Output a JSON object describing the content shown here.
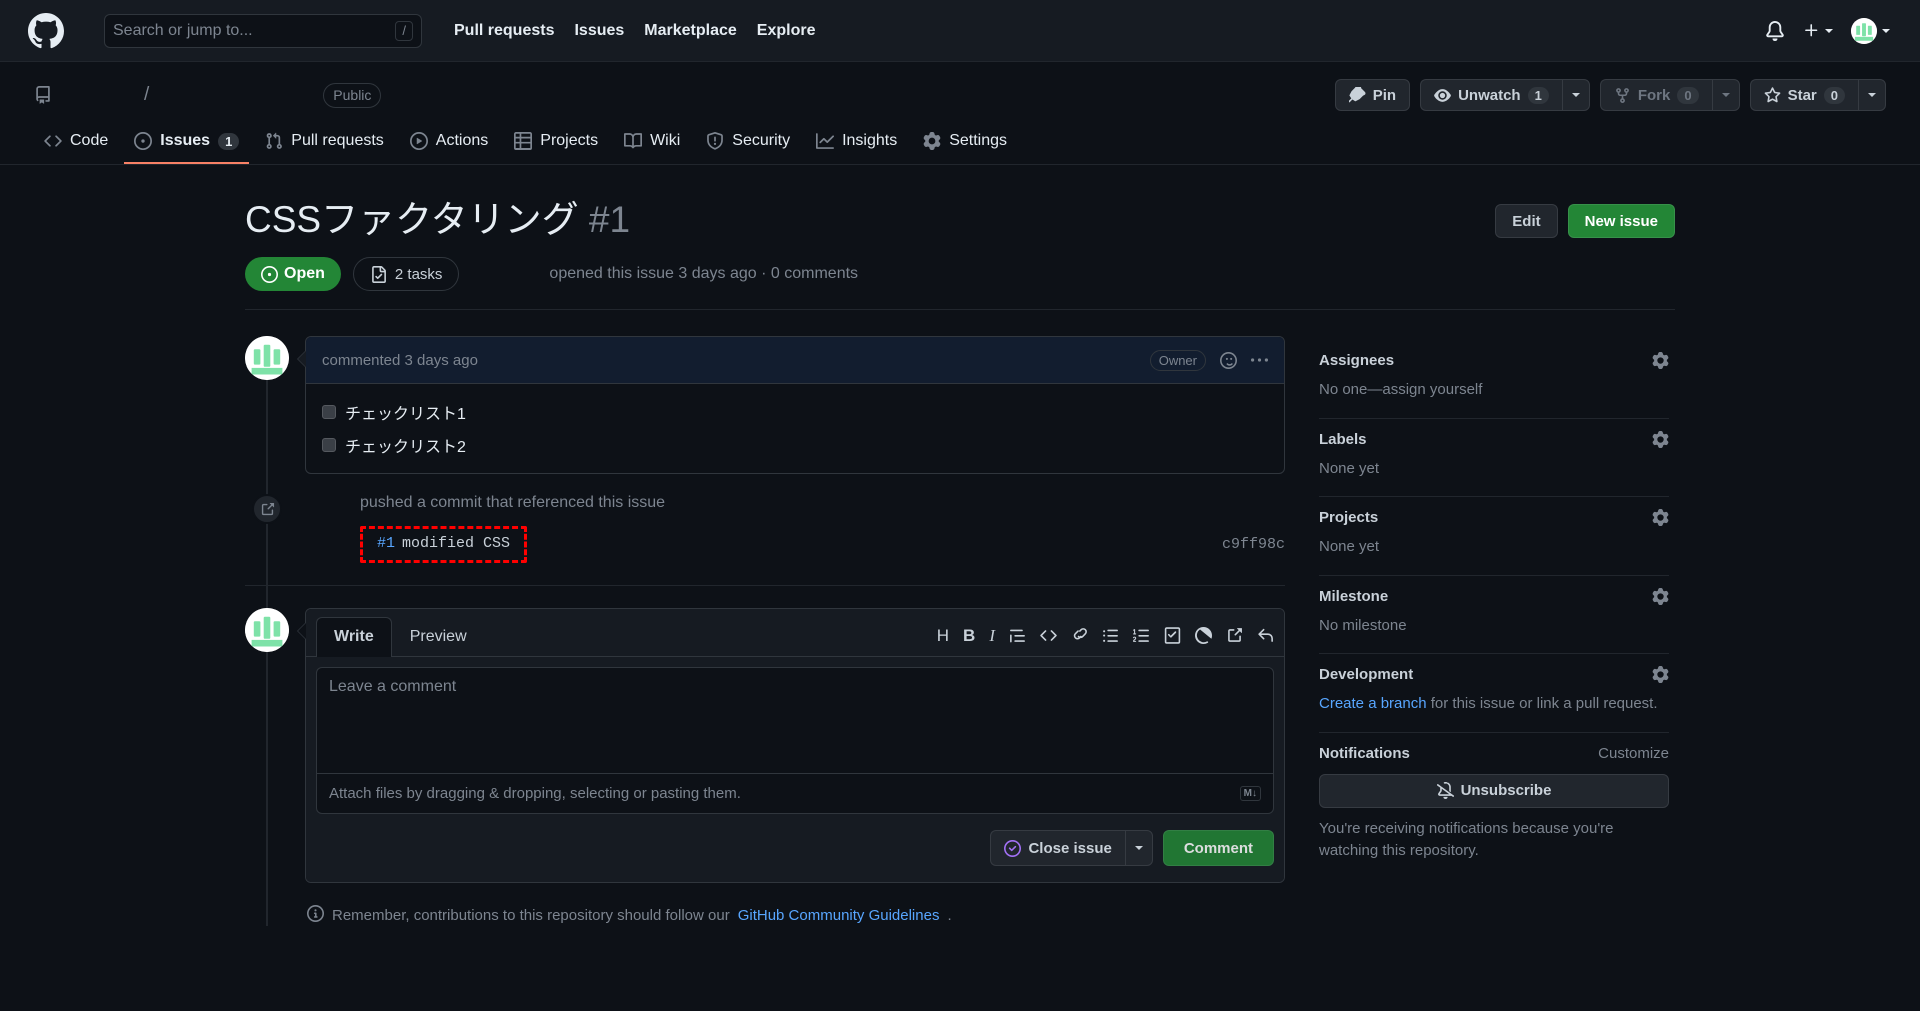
{
  "header": {
    "logo_icon": "github-mark-icon",
    "search_placeholder": "Search or jump to...",
    "search_value": "",
    "slash_key": "/",
    "nav": [
      {
        "label": "Pull requests"
      },
      {
        "label": "Issues"
      },
      {
        "label": "Marketplace"
      },
      {
        "label": "Explore"
      }
    ],
    "notifications_icon": "bell-icon",
    "create_new_icon": "plus-icon",
    "profile_icon": "avatar"
  },
  "repo": {
    "repo_icon": "repo-icon",
    "owner": "",
    "separator": "/",
    "name": "",
    "visibility": "Public",
    "actions": {
      "pin_label": "Pin",
      "pin_icon": "pin-icon",
      "unwatch_label": "Unwatch",
      "unwatch_icon": "eye-icon",
      "unwatch_count": "1",
      "fork_label": "Fork",
      "fork_icon": "fork-icon",
      "fork_count": "0",
      "star_label": "Star",
      "star_icon": "star-icon",
      "star_count": "0"
    },
    "nav": [
      {
        "label": "Code",
        "icon": "code-icon",
        "count": null,
        "selected": false
      },
      {
        "label": "Issues",
        "icon": "issue-opened-icon",
        "count": "1",
        "selected": true
      },
      {
        "label": "Pull requests",
        "icon": "git-pull-request-icon",
        "count": null,
        "selected": false
      },
      {
        "label": "Actions",
        "icon": "play-icon",
        "count": null,
        "selected": false
      },
      {
        "label": "Projects",
        "icon": "table-icon",
        "count": null,
        "selected": false
      },
      {
        "label": "Wiki",
        "icon": "book-icon",
        "count": null,
        "selected": false
      },
      {
        "label": "Security",
        "icon": "shield-icon",
        "count": null,
        "selected": false
      },
      {
        "label": "Insights",
        "icon": "graph-icon",
        "count": null,
        "selected": false
      },
      {
        "label": "Settings",
        "icon": "gear-icon",
        "count": null,
        "selected": false
      }
    ]
  },
  "issue": {
    "title": "CSSファクタリング",
    "number": "#1",
    "edit_label": "Edit",
    "new_issue_label": "New issue",
    "state": "Open",
    "state_icon": "issue-opened-icon",
    "tasks_label": "2 tasks",
    "tasks_icon": "tasklist-icon",
    "meta": "opened this issue 3 days ago · 0 comments"
  },
  "comment": {
    "author_avatar": "avatar",
    "timestamp": "commented 3 days ago",
    "author_role": "Owner",
    "reaction_icon": "smiley-icon",
    "menu_icon": "kebab-horizontal-icon",
    "tasks": [
      {
        "label": "チェックリスト1",
        "checked": false
      },
      {
        "label": "チェックリスト2",
        "checked": false
      }
    ]
  },
  "event": {
    "icon": "cross-reference-icon",
    "title": "pushed a commit that referenced this issue",
    "commit_ref": "#1",
    "commit_message": "modified CSS",
    "commit_sha": "c9ff98c",
    "highlight_color": "#ff0000"
  },
  "form": {
    "avatar": "avatar",
    "tabs": [
      {
        "label": "Write",
        "active": true
      },
      {
        "label": "Preview",
        "active": false
      }
    ],
    "toolbar": [
      {
        "icon": "heading-icon",
        "glyph": "H"
      },
      {
        "icon": "bold-icon",
        "glyph": "B"
      },
      {
        "icon": "italic-icon",
        "glyph": "I"
      },
      {
        "icon": "quote-icon",
        "glyph": ""
      },
      {
        "icon": "code-icon",
        "glyph": ""
      },
      {
        "icon": "link-icon",
        "glyph": ""
      },
      {
        "icon": "unordered-list-icon",
        "glyph": ""
      },
      {
        "icon": "ordered-list-icon",
        "glyph": ""
      },
      {
        "icon": "tasklist-icon",
        "glyph": ""
      },
      {
        "icon": "mention-icon",
        "glyph": ""
      },
      {
        "icon": "cross-reference-icon",
        "glyph": ""
      },
      {
        "icon": "reply-icon",
        "glyph": ""
      }
    ],
    "textarea_placeholder": "Leave a comment",
    "textarea_value": "",
    "attach_hint": "Attach files by dragging & dropping, selecting or pasting them.",
    "markdown_badge": "M↓",
    "close_issue_label": "Close issue",
    "close_issue_icon": "issue-closed-icon",
    "comment_label": "Comment",
    "dropdown_icon": "triangle-down-icon",
    "guideline_icon": "info-icon",
    "guideline_text": "Remember, contributions to this repository should follow our ",
    "guideline_link": "GitHub Community Guidelines",
    "guideline_suffix": "."
  },
  "sidebar": {
    "sections": [
      {
        "title": "Assignees",
        "gear": "gear-icon",
        "body": "No one—assign yourself"
      },
      {
        "title": "Labels",
        "gear": "gear-icon",
        "body": "None yet"
      },
      {
        "title": "Projects",
        "gear": "gear-icon",
        "body": "None yet"
      },
      {
        "title": "Milestone",
        "gear": "gear-icon",
        "body": "No milestone"
      }
    ],
    "development": {
      "title": "Development",
      "gear": "gear-icon",
      "link": "Create a branch",
      "text": " for this issue or link a pull request."
    },
    "notifications": {
      "title": "Notifications",
      "customize": "Customize",
      "button_label": "Unsubscribe",
      "button_icon": "bell-slash-icon",
      "description": "You're receiving notifications because you're watching this repository."
    }
  },
  "colors": {
    "page_bg": "#0d1117",
    "header_bg": "#161b22",
    "accent_green": "#238636",
    "accent_blue": "#58a6ff",
    "accent_purple": "#a371f7",
    "border": "#30363d",
    "muted": "#7d8590",
    "tab_underline": "#f78166",
    "highlight_red": "#ff0000",
    "comment_head_bg": "#121d2f"
  }
}
